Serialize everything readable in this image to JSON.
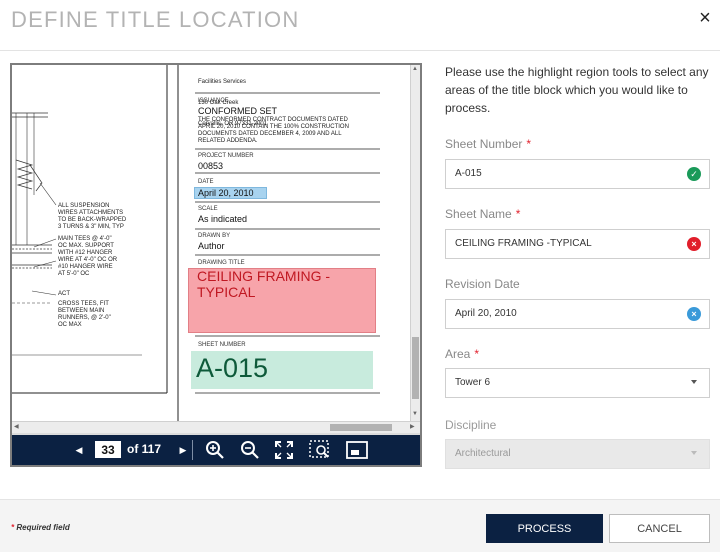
{
  "dialog": {
    "title": "DEFINE TITLE LOCATION",
    "close_glyph": "×"
  },
  "viewer": {
    "toolbar": {
      "prev_glyph": "◀",
      "next_glyph": "▶",
      "current_page": "33",
      "page_of": "of 117"
    },
    "drawing": {
      "address_lines": [
        "Facilities Services",
        "130 Oak Creek",
        "Corvallis, OR 97331-2001"
      ],
      "issuance_label": "ISSUANCE",
      "issuance_value": "CONFORMED SET",
      "issuance_note": "THE CONFORMED CONTRACT DOCUMENTS DATED\nAPRIL 20, 2010 CONTAIN THE 100% CONSTRUCTION\nDOCUMENTS DATED DECEMBER 4, 2009 AND ALL\nRELATED ADDENDA.",
      "project_number_label": "PROJECT NUMBER",
      "project_number_value": "00853",
      "date_label": "DATE",
      "date_value": "April 20, 2010",
      "scale_label": "SCALE",
      "scale_value": "As indicated",
      "drawn_by_label": "DRAWN BY",
      "drawn_by_value": "Author",
      "drawing_title_label": "DRAWING TITLE",
      "drawing_title_value": "CEILING FRAMING -\nTYPICAL",
      "sheet_number_label": "SHEET NUMBER",
      "sheet_number_value": "A-015",
      "note_suspension": "ALL SUSPENSION\nWIRES ATTACHMENTS\nTO BE BACK-WRAPPED\n3 TURNS & 3\" MIN, TYP",
      "note_main_tees": "MAIN TEES @ 4'-0\"\nOC MAX. SUPPORT\nWITH #12 HANGER\nWIRE AT 4'-0\" OC OR\n#10 HANGER WIRE\nAT 5'-0\" OC",
      "note_act": "ACT",
      "note_cross_tees": "CROSS TEES, FIT\nBETWEEN MAIN\nRUNNERS, @ 2'-0\"\nOC MAX"
    }
  },
  "panel": {
    "intro": "Please use the highlight region tools to select any areas of the title block which you would like to process.",
    "required_marker": "*",
    "fields": {
      "sheet_number": {
        "label": "Sheet Number",
        "value": "A-015",
        "status_glyph": "✓"
      },
      "sheet_name": {
        "label": "Sheet Name",
        "value": "CEILING FRAMING -TYPICAL",
        "status_glyph": "×"
      },
      "revision_date": {
        "label": "Revision Date",
        "value": "April 20, 2010",
        "status_glyph": "×"
      },
      "area": {
        "label": "Area",
        "value": "Tower 6"
      },
      "discipline": {
        "label": "Discipline",
        "value": "Architectural"
      }
    }
  },
  "footer": {
    "required_star": "*",
    "required_note": "Required field",
    "process_label": "PROCESS",
    "cancel_label": "CANCEL"
  },
  "colors": {
    "navy": "#0b2142",
    "required_red": "#e2232f",
    "status_green": "#1a9a59",
    "status_red": "#e11e2b",
    "status_blue": "#3a9ad9",
    "highlight_date": "#a8d3ef",
    "highlight_title": "#f7a4aa",
    "highlight_sheet": "#c8ebdd"
  },
  "icons": {
    "toolbar": [
      "prev-page-icon",
      "next-page-icon",
      "zoom-in-icon",
      "zoom-out-icon",
      "fit-to-screen-icon",
      "zoom-region-icon",
      "thumbnail-icon"
    ],
    "status": [
      "check-circle-icon",
      "error-circle-icon",
      "clear-circle-icon"
    ],
    "select": "caret-down-icon"
  }
}
